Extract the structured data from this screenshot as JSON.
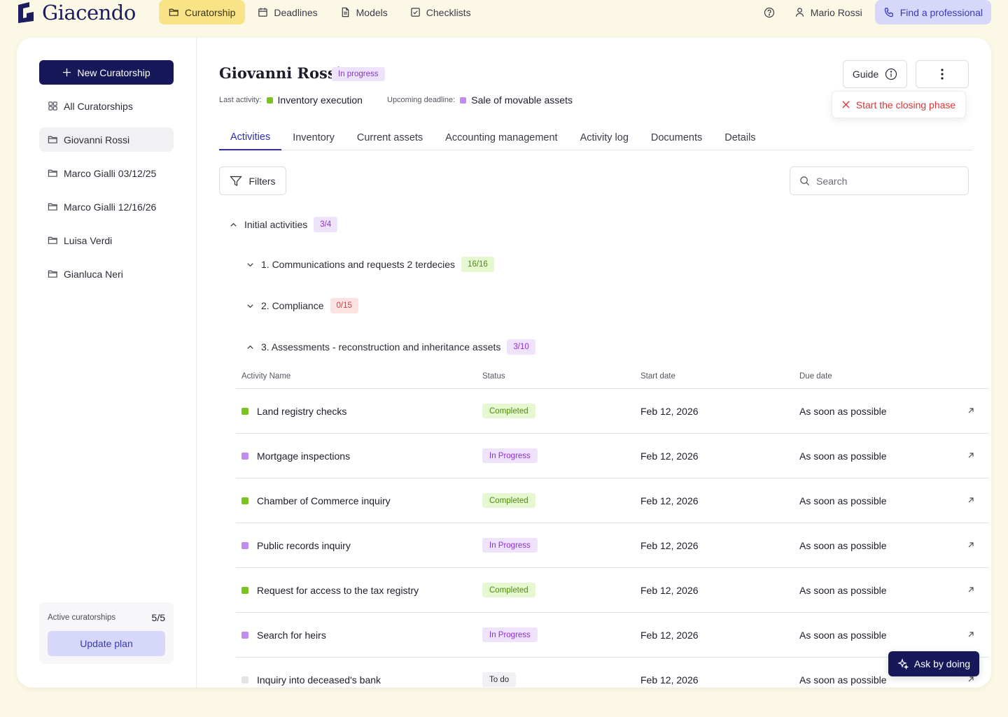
{
  "app": {
    "name": "Giacendo"
  },
  "nav": {
    "items": [
      {
        "label": "Curatorship",
        "icon": "folder-icon",
        "active": true
      },
      {
        "label": "Deadlines",
        "icon": "calendar-icon",
        "active": false
      },
      {
        "label": "Models",
        "icon": "document-icon",
        "active": false
      },
      {
        "label": "Checklists",
        "icon": "checkbox-icon",
        "active": false
      }
    ],
    "user": "Mario Rossi",
    "find_pro": "Find a professional"
  },
  "sidebar": {
    "new_button": "New Curatorship",
    "items": [
      {
        "label": "All Curatorships",
        "icon": "grid-icon"
      },
      {
        "label": "Giovanni Rossi",
        "icon": "folder-icon",
        "selected": true
      },
      {
        "label": "Marco Gialli 03/12/25",
        "icon": "folder-icon"
      },
      {
        "label": "Marco Gialli 12/16/26",
        "icon": "folder-icon"
      },
      {
        "label": "Luisa Verdi",
        "icon": "folder-icon"
      },
      {
        "label": "Gianluca Neri",
        "icon": "folder-icon"
      }
    ],
    "plan": {
      "label": "Active curatorships",
      "count": "5/5",
      "button": "Update plan"
    }
  },
  "header": {
    "title": "Giovanni Rossi",
    "status": "In progress",
    "last_activity_label": "Last activity:",
    "last_activity_value": "Inventory execution",
    "deadline_label": "Upcoming deadline:",
    "deadline_value": "Sale of movable assets",
    "guide_label": "Guide",
    "closing_label": "Start the closing phase"
  },
  "tabs": [
    "Activities",
    "Inventory",
    "Current assets",
    "Accounting management",
    "Activity log",
    "Documents",
    "Details"
  ],
  "toolbar": {
    "filters_label": "Filters",
    "search_placeholder": "Search"
  },
  "groups": [
    {
      "label": "Initial activities",
      "count": "3/4"
    },
    {
      "label": "1. Communications and requests 2 terdecies",
      "count": "16/16"
    },
    {
      "label": "2. Compliance",
      "count": "0/15"
    },
    {
      "label": "3. Assessments - reconstruction and inheritance assets",
      "count": "3/10"
    }
  ],
  "table": {
    "columns": [
      "Activity Name",
      "Status",
      "Start date",
      "Due date"
    ],
    "rows": [
      {
        "name": "Land registry checks",
        "status": "Completed",
        "start": "Feb 12, 2026",
        "due": "As soon as possible"
      },
      {
        "name": "Mortgage inspections",
        "status": "In Progress",
        "start": "Feb 12, 2026",
        "due": "As soon as possible"
      },
      {
        "name": "Chamber of Commerce inquiry",
        "status": "Completed",
        "start": "Feb 12, 2026",
        "due": "As soon as possible"
      },
      {
        "name": "Public records inquiry",
        "status": "In Progress",
        "start": "Feb 12, 2026",
        "due": "As soon as possible"
      },
      {
        "name": "Request for access to the tax registry",
        "status": "Completed",
        "start": "Feb 12, 2026",
        "due": "As soon as possible"
      },
      {
        "name": "Search for heirs",
        "status": "In Progress",
        "start": "Feb 12, 2026",
        "due": "As soon as possible"
      },
      {
        "name": "Inquiry into deceased's bank",
        "status": "To do",
        "start": "Feb 12, 2026",
        "due": "As soon as possible"
      }
    ]
  },
  "assistant": {
    "label": "Ask by doing"
  },
  "colors": {
    "brand": "#16185a",
    "accent_yellow": "#f8e387",
    "completed": "#7ac41f",
    "in_progress": "#c48cf2",
    "todo": "#e3e3e6",
    "danger": "#e03535"
  }
}
